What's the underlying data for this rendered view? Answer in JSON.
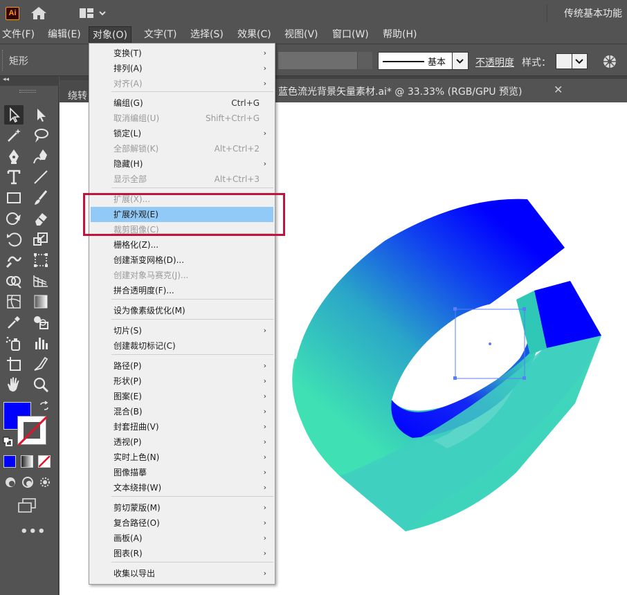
{
  "app": {
    "logo_text": "Ai",
    "workspace": "传统基本功能"
  },
  "menubar": {
    "items": [
      {
        "label": "文件(F)"
      },
      {
        "label": "编辑(E)"
      },
      {
        "label": "对象(O)"
      },
      {
        "label": "文字(T)"
      },
      {
        "label": "选择(S)"
      },
      {
        "label": "效果(C)"
      },
      {
        "label": "视图(V)"
      },
      {
        "label": "窗口(W)"
      },
      {
        "label": "帮助(H)"
      }
    ]
  },
  "controlbar": {
    "selection_type": "矩形",
    "stroke_profile": "基本",
    "opacity_label": "不透明度",
    "style_label": "样式："
  },
  "document": {
    "tab_hidden_label": "绕转",
    "tab_label": "蓝色流光背景矢量素材.ai* @ 33.33% (RGB/GPU 预览)",
    "close_symbol": "✕"
  },
  "toolbar": {
    "collapse_symbol": "◂◂",
    "fill_color": "#0000ff",
    "more_symbol": "•••"
  },
  "object_menu": {
    "items": [
      {
        "label": "变换(T)",
        "shortcut": "",
        "submenu": true,
        "disabled": false
      },
      {
        "label": "排列(A)",
        "shortcut": "",
        "submenu": true,
        "disabled": false
      },
      {
        "label": "对齐(A)",
        "shortcut": "",
        "submenu": true,
        "disabled": true
      },
      {
        "label": "编组(G)",
        "shortcut": "Ctrl+G",
        "submenu": false,
        "disabled": false
      },
      {
        "label": "取消编组(U)",
        "shortcut": "Shift+Ctrl+G",
        "submenu": false,
        "disabled": true
      },
      {
        "label": "锁定(L)",
        "shortcut": "",
        "submenu": true,
        "disabled": false
      },
      {
        "label": "全部解锁(K)",
        "shortcut": "Alt+Ctrl+2",
        "submenu": false,
        "disabled": true
      },
      {
        "label": "隐藏(H)",
        "shortcut": "",
        "submenu": true,
        "disabled": false
      },
      {
        "label": "显示全部",
        "shortcut": "Alt+Ctrl+3",
        "submenu": false,
        "disabled": true
      },
      {
        "label": "扩展(X)...",
        "shortcut": "",
        "submenu": false,
        "disabled": true
      },
      {
        "label": "扩展外观(E)",
        "shortcut": "",
        "submenu": false,
        "disabled": false,
        "highlighted": true
      },
      {
        "label": "裁剪图像(C)",
        "shortcut": "",
        "submenu": false,
        "disabled": true
      },
      {
        "label": "栅格化(Z)...",
        "shortcut": "",
        "submenu": false,
        "disabled": false
      },
      {
        "label": "创建渐变网格(D)...",
        "shortcut": "",
        "submenu": false,
        "disabled": false
      },
      {
        "label": "创建对象马赛克(J)...",
        "shortcut": "",
        "submenu": false,
        "disabled": true
      },
      {
        "label": "拼合透明度(F)...",
        "shortcut": "",
        "submenu": false,
        "disabled": false
      },
      {
        "label": "设为像素级优化(M)",
        "shortcut": "",
        "submenu": false,
        "disabled": false
      },
      {
        "label": "切片(S)",
        "shortcut": "",
        "submenu": true,
        "disabled": false
      },
      {
        "label": "创建裁切标记(C)",
        "shortcut": "",
        "submenu": false,
        "disabled": false
      },
      {
        "label": "路径(P)",
        "shortcut": "",
        "submenu": true,
        "disabled": false
      },
      {
        "label": "形状(P)",
        "shortcut": "",
        "submenu": true,
        "disabled": false
      },
      {
        "label": "图案(E)",
        "shortcut": "",
        "submenu": true,
        "disabled": false
      },
      {
        "label": "混合(B)",
        "shortcut": "",
        "submenu": true,
        "disabled": false
      },
      {
        "label": "封套扭曲(V)",
        "shortcut": "",
        "submenu": true,
        "disabled": false
      },
      {
        "label": "透视(P)",
        "shortcut": "",
        "submenu": true,
        "disabled": false
      },
      {
        "label": "实时上色(N)",
        "shortcut": "",
        "submenu": true,
        "disabled": false
      },
      {
        "label": "图像描摹",
        "shortcut": "",
        "submenu": true,
        "disabled": false
      },
      {
        "label": "文本绕排(W)",
        "shortcut": "",
        "submenu": true,
        "disabled": false
      },
      {
        "label": "剪切蒙版(M)",
        "shortcut": "",
        "submenu": true,
        "disabled": false
      },
      {
        "label": "复合路径(O)",
        "shortcut": "",
        "submenu": true,
        "disabled": false
      },
      {
        "label": "画板(A)",
        "shortcut": "",
        "submenu": true,
        "disabled": false
      },
      {
        "label": "图表(R)",
        "shortcut": "",
        "submenu": true,
        "disabled": false
      },
      {
        "label": "收集以导出",
        "shortcut": "",
        "submenu": true,
        "disabled": false
      }
    ],
    "arrow_symbol": "›"
  },
  "colors": {
    "ui_dark": "#535353",
    "menu_bg": "#f0f0f0",
    "menu_highlight": "#91c9f7",
    "annotation_red": "#c0143c",
    "art_blue": "#0000ff",
    "art_teal": "#44d1b5"
  }
}
